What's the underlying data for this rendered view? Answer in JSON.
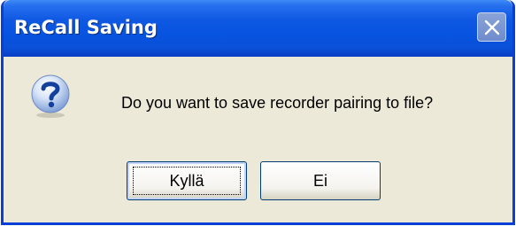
{
  "window": {
    "title": "ReCall Saving"
  },
  "dialog": {
    "icon": "question-icon",
    "message": "Do you want to save recorder pairing to file?"
  },
  "buttons": {
    "yes_label": "Kyllä",
    "no_label": "Ei"
  },
  "colors": {
    "titlebar_blue": "#0754e0",
    "dialog_background": "#ece9d8",
    "close_button": "#7b95cf"
  }
}
